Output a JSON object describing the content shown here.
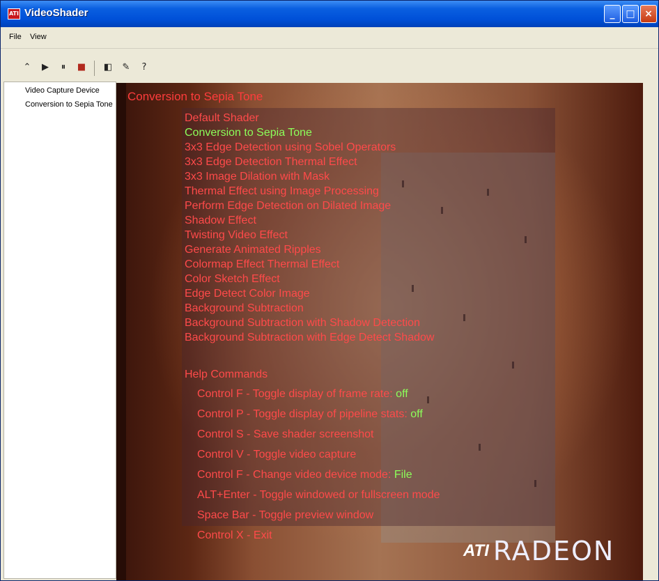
{
  "window": {
    "title": "VideoShader",
    "app_icon_text": "ATI",
    "controls": {
      "minimize": "_",
      "maximize": "□",
      "close": "×"
    }
  },
  "menu": {
    "items": [
      "File",
      "View"
    ]
  },
  "toolbar": {
    "tools": [
      {
        "name": "open-icon",
        "glyph": "⌃"
      },
      {
        "name": "play-icon",
        "glyph": "▶"
      },
      {
        "name": "pause-icon",
        "glyph": "⏸"
      },
      {
        "name": "stop-icon",
        "glyph": "■"
      },
      {
        "name": "capture-icon",
        "glyph": "◧"
      },
      {
        "name": "settings-icon",
        "glyph": "✎"
      },
      {
        "name": "help-icon",
        "glyph": "?"
      }
    ]
  },
  "sidebar": {
    "items": [
      "Video Capture Device",
      "Conversion to Sepia Tone"
    ]
  },
  "video": {
    "title": "Conversion to Sepia Tone",
    "shader_list": [
      "Default Shader",
      "Conversion to Sepia Tone",
      "3x3 Edge Detection using Sobel Operators",
      "3x3 Edge Detection Thermal Effect",
      "3x3 Image Dilation with Mask",
      "Thermal Effect using Image Processing",
      "Perform Edge Detection on Dilated Image",
      "Shadow Effect",
      "Twisting Video Effect",
      "Generate Animated Ripples",
      "Colormap Effect Thermal Effect",
      "Color Sketch Effect",
      "Edge Detect Color Image",
      "Background Subtraction",
      "Background Subtraction with Shadow Detection",
      "Background Subtraction with Edge Detect Shadow"
    ],
    "active_index": 1,
    "help_header": "Help Commands",
    "commands": [
      {
        "text": "Control F - Toggle display of frame rate:",
        "state": "off"
      },
      {
        "text": "Control P - Toggle display of pipeline stats:",
        "state": "off"
      },
      {
        "text": "Control S - Save shader screenshot",
        "state": ""
      },
      {
        "text": "Control V - Toggle video capture",
        "state": ""
      },
      {
        "text": "Control F - Change video device mode:",
        "state": "File"
      }
    ],
    "extra": [
      "ALT+Enter - Toggle windowed or fullscreen mode",
      "Space Bar - Toggle preview window",
      "Control X - Exit"
    ],
    "logo": {
      "mark": "ATI",
      "word": "RADEON"
    }
  },
  "colors": {
    "titlebar": "#0050d8",
    "menu_text": "#ff4a4a",
    "active_text": "#8cff5a",
    "video_bg": "#5c2714"
  }
}
